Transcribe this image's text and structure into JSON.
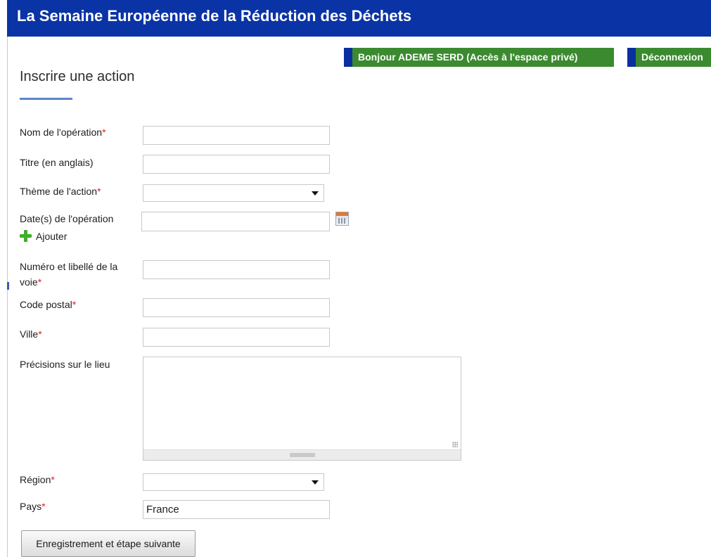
{
  "header": {
    "title": "La Semaine Européenne de la Réduction des Déchets"
  },
  "topbar": {
    "account_label": "Bonjour ADEME SERD (Accès à l'espace privé)",
    "logout_label": "Déconnexion"
  },
  "page": {
    "title": "Inscrire une action"
  },
  "form": {
    "required_mark": "*",
    "nom_label": "Nom de l'opération",
    "titre_label": "Titre (en anglais)",
    "theme_label": "Thème de l'action",
    "date_label": "Date(s) de l'opération",
    "add_label": "Ajouter",
    "voie_label_line1": "Numéro et libellé de la",
    "voie_label_line2": "voie",
    "cp_label": "Code postal",
    "ville_label": "Ville",
    "precisions_label": "Précisions sur le lieu",
    "region_label": "Région",
    "pays_label": "Pays",
    "pays_value": "France",
    "submit_label": "Enregistrement et étape suivante"
  },
  "icons": {
    "calendar": "calendar-icon",
    "add": "plus-icon",
    "dropdown": "chevron-down-icon"
  },
  "colors": {
    "header_bg": "#0a33a5",
    "button_green": "#3b8a2f",
    "button_accent": "#0b2f9c",
    "required": "#e0192b",
    "title_underline": "#5b86c9"
  }
}
